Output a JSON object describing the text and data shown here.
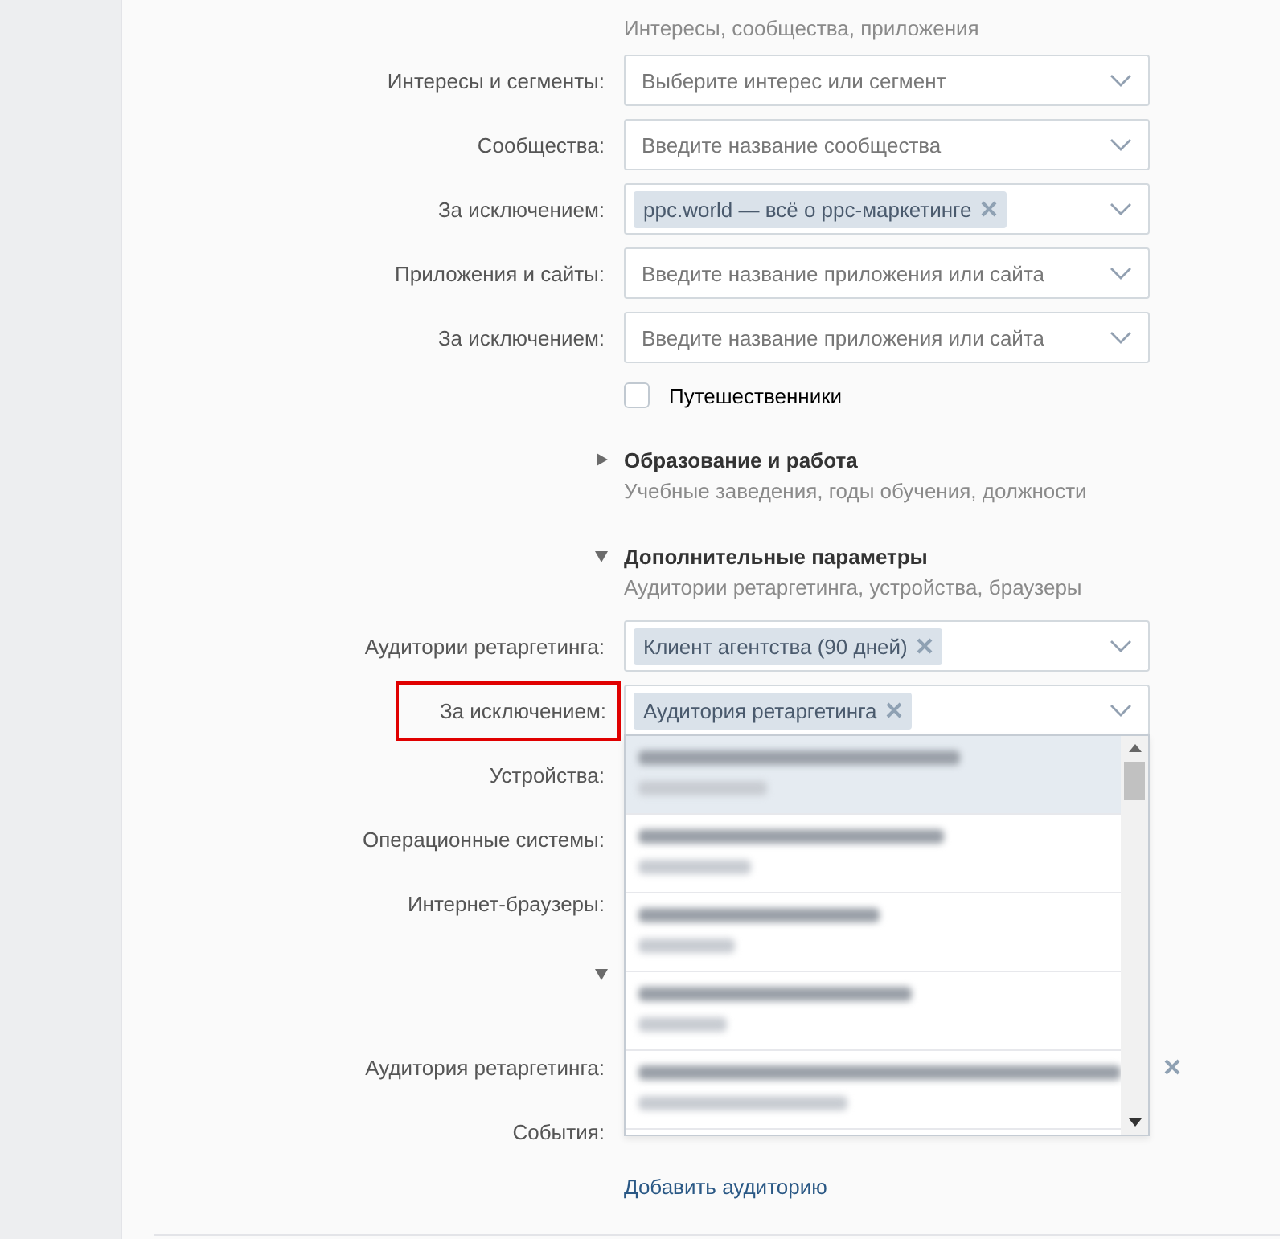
{
  "blocks": [
    {
      "kind": "subtitle",
      "text": "Интересы, сообщества, приложения"
    },
    {
      "kind": "field",
      "label": "Интересы и сегменты:",
      "placeholder": "Выберите интерес или сегмент"
    },
    {
      "kind": "field",
      "label": "Сообщества:",
      "placeholder": "Введите название сообщества"
    },
    {
      "kind": "field",
      "label": "За исключением:",
      "tags": [
        "ppc.world — всё о ppc-маркетинге"
      ]
    },
    {
      "kind": "field",
      "label": "Приложения и сайты:",
      "placeholder": "Введите название приложения или сайта"
    },
    {
      "kind": "field",
      "label": "За исключением:",
      "placeholder": "Введите название приложения или сайта"
    },
    {
      "kind": "checkbox",
      "label": "Путешественники",
      "checked": false
    },
    {
      "kind": "section",
      "title": "Образование и работа",
      "subtitle": "Учебные заведения, годы обучения, должности",
      "expanded": false
    },
    {
      "kind": "section",
      "title": "Дополнительные параметры",
      "subtitle": "Аудитории ретаргетинга, устройства, браузеры",
      "expanded": true
    },
    {
      "kind": "field",
      "label": "Аудитории ретаргетинга:",
      "tags": [
        "Клиент агентства (90 дней)"
      ]
    },
    {
      "kind": "field",
      "label": "За исключением:",
      "tags": [
        "Аудитория ретаргетинга"
      ],
      "highlighted": true,
      "open": true
    },
    {
      "kind": "label",
      "label": "Устройства:"
    },
    {
      "kind": "label",
      "label": "Операционные системы:"
    },
    {
      "kind": "label",
      "label": "Интернет-браузеры:"
    },
    {
      "kind": "toggle",
      "expanded": true
    },
    {
      "kind": "label",
      "label": "Аудитория ретаргетинга:",
      "removable": true
    },
    {
      "kind": "label",
      "label": "События:"
    },
    {
      "kind": "link",
      "text": "Добавить аудиторию"
    }
  ],
  "dropdown": {
    "options": [
      {
        "selected": true
      },
      {
        "selected": false
      },
      {
        "selected": false
      },
      {
        "selected": false
      },
      {
        "selected": false
      }
    ]
  }
}
